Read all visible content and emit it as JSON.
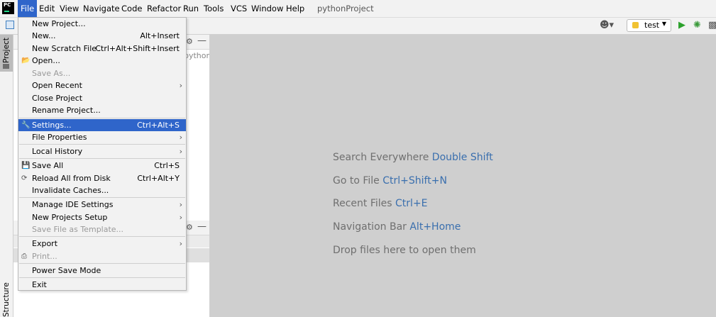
{
  "menubar": {
    "logo": "PC",
    "items": [
      "File",
      "Edit",
      "View",
      "Navigate",
      "Code",
      "Refactor",
      "Run",
      "Tools",
      "VCS",
      "Window",
      "Help"
    ],
    "project_title": "pythonProject"
  },
  "toolbar": {
    "run_config": "test",
    "icons": [
      "layout-icon",
      "vcs-user-icon",
      "run-icon",
      "debug-icon",
      "coverage-icon"
    ]
  },
  "tool_strip": {
    "project_tab": "Project",
    "structure_tab": "Structure"
  },
  "project_panel": {
    "tree_item": "pythonProje"
  },
  "file_menu": {
    "items": [
      {
        "label": "New Project...",
        "shortcut": ""
      },
      {
        "label": "New...",
        "shortcut": "Alt+Insert"
      },
      {
        "label": "New Scratch File",
        "shortcut": "Ctrl+Alt+Shift+Insert"
      },
      {
        "label": "Open...",
        "shortcut": ""
      },
      {
        "label": "Save As...",
        "shortcut": ""
      },
      {
        "label": "Open Recent",
        "shortcut": ""
      },
      {
        "label": "Close Project",
        "shortcut": ""
      },
      {
        "label": "Rename Project...",
        "shortcut": ""
      },
      {
        "label": "Settings...",
        "shortcut": "Ctrl+Alt+S"
      },
      {
        "label": "File Properties",
        "shortcut": ""
      },
      {
        "label": "Local History",
        "shortcut": ""
      },
      {
        "label": "Save All",
        "shortcut": "Ctrl+S"
      },
      {
        "label": "Reload All from Disk",
        "shortcut": "Ctrl+Alt+Y"
      },
      {
        "label": "Invalidate Caches...",
        "shortcut": ""
      },
      {
        "label": "Manage IDE Settings",
        "shortcut": ""
      },
      {
        "label": "New Projects Setup",
        "shortcut": ""
      },
      {
        "label": "Save File as Template...",
        "shortcut": ""
      },
      {
        "label": "Export",
        "shortcut": ""
      },
      {
        "label": "Print...",
        "shortcut": ""
      },
      {
        "label": "Power Save Mode",
        "shortcut": ""
      },
      {
        "label": "Exit",
        "shortcut": ""
      }
    ]
  },
  "editor": {
    "hints": [
      {
        "text": "Search Everywhere",
        "key": "Double Shift"
      },
      {
        "text": "Go to File",
        "key": "Ctrl+Shift+N"
      },
      {
        "text": "Recent Files",
        "key": "Ctrl+E"
      },
      {
        "text": "Navigation Bar",
        "key": "Alt+Home"
      },
      {
        "text": "Drop files here to open them",
        "key": ""
      }
    ]
  },
  "colors": {
    "selection": "#2f65ca",
    "hint_key": "#3a6fae"
  }
}
